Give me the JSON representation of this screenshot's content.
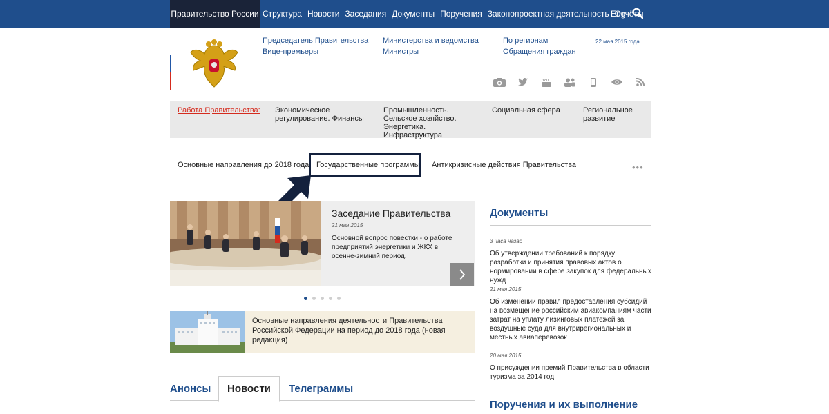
{
  "topbar": {
    "brand": "Правительство России",
    "nav": [
      "Структура",
      "Новости",
      "Заседания",
      "Документы",
      "Поручения",
      "Законопроектная деятельность",
      "Отчёты"
    ],
    "lang": "Eng",
    "search_icon": "search-icon",
    "bg_color": "#1f4e8c"
  },
  "header": {
    "links": {
      "chairman": "Председатель Правительства",
      "vice_premiers": "Вице-премьеры",
      "ministries": "Министерства и ведомства",
      "ministers": "Министры",
      "regions": "По регионам",
      "appeals": "Обращения граждан"
    },
    "date": "22 мая 2015 года",
    "social_icons": [
      "camera-icon",
      "twitter-icon",
      "youtube-icon",
      "people-icon",
      "mobile-icon",
      "eye-icon",
      "rss-icon"
    ]
  },
  "workbar": {
    "label": "Работа Правительства:",
    "items": [
      "Экономическое регулирование. Финансы",
      "Промышленность. Сельское хозяйство. Энергетика. Инфраструктура",
      "Социальная сфера",
      "Региональное развитие"
    ]
  },
  "tabs_row": {
    "items": [
      "Основные направления до 2018 года",
      "Государственные программы",
      "Антикризисные действия Правительства"
    ],
    "highlighted": "Государственные программы"
  },
  "slider": {
    "title": "Заседание Правительства",
    "date": "21 мая 2015",
    "description": "Основной вопрос повестки - о работе предприятий энергетики и ЖКХ в осенне-зимний период.",
    "active_dot": 1,
    "dot_count": 5
  },
  "banner": {
    "text": "Основные направления деятельности Правительства Российской Федерации на период до 2018 года (новая редакция)"
  },
  "news_tabs": {
    "items": [
      "Анонсы",
      "Новости",
      "Телеграммы"
    ],
    "active": "Новости"
  },
  "documents": {
    "title": "Документы",
    "items": [
      {
        "date": "3 часа назад",
        "text": "Об утверждении требований к порядку разработки и принятия правовых актов о нормировании в сфере закупок для федеральных нужд"
      },
      {
        "date": "21 мая 2015",
        "text": "Об изменении правил предоставления субсидий на возмещение российским авиакомпаниям части затрат на уплату лизинговых платежей за воздушные суда для внутрирегиональных и местных авиаперевозок"
      },
      {
        "date": "20 мая 2015",
        "text": "О присуждении премий Правительства в области туризма за 2014 год"
      }
    ]
  },
  "orders": {
    "title": "Поручения и их выполнение"
  }
}
